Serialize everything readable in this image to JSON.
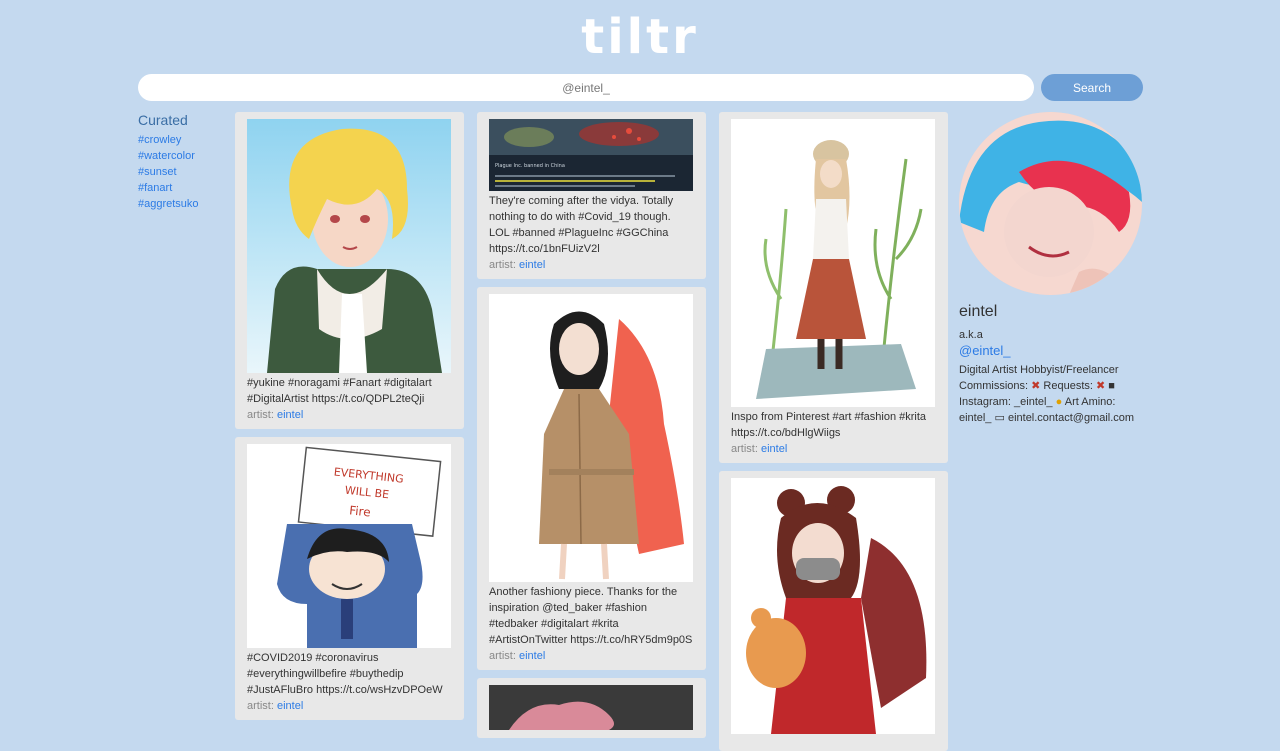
{
  "app": {
    "logo": "tiltr"
  },
  "search": {
    "placeholder": "@eintel_",
    "button_label": "Search"
  },
  "curated": {
    "title": "Curated",
    "tags": [
      "#crowley",
      "#watercolor",
      "#sunset",
      "#fanart",
      "#aggretsuko"
    ]
  },
  "posts": {
    "yukine": {
      "caption": "#yukine #noragami #Fanart #digitalart #DigitalArtist https://t.co/QDPL2teQji",
      "artist_label": "artist:",
      "artist": "eintel"
    },
    "covid": {
      "image_text": "EVERYTHING WILL BE Fire",
      "caption": "#COVID2019 #coronavirus #everythingwillbefire #buythedip #JustAFluBro https://t.co/wsHzvDPOeW",
      "artist_label": "artist:",
      "artist": "eintel"
    },
    "plague": {
      "image_text": "Plague Inc. banned in China",
      "caption": "They're coming after the vidya. Totally nothing to do with #Covid_19 though. LOL #banned #PlagueInc #GGChina https://t.co/1bnFUizV2l",
      "artist_label": "artist:",
      "artist": "eintel"
    },
    "fashion": {
      "caption": "Another fashiony piece. Thanks for the inspiration @ted_baker #fashion #tedbaker #digitalart #krita #ArtistOnTwitter https://t.co/hRY5dm9p0S",
      "artist_label": "artist:",
      "artist": "eintel"
    },
    "pinterest": {
      "caption": "Inspo from Pinterest #art #fashion #krita https://t.co/bdHlgWiigs",
      "artist_label": "artist:",
      "artist": "eintel"
    }
  },
  "profile": {
    "name": "eintel",
    "aka": "a.k.a",
    "handle": "@eintel_",
    "bio_line1": "Digital Artist Hobbyist/Freelancer",
    "commissions_label": "Commissions:",
    "requests_label": "Requests:",
    "instagram_label": "Instagram: _eintel_",
    "art_amino_label": "Art Amino:",
    "art_amino_value": "eintel_",
    "email": "eintel.contact@gmail.com"
  },
  "colors": {
    "background": "#c4d9ef",
    "accent": "#6d9fd6",
    "link": "#2c7be5",
    "card": "#e8e8e8"
  }
}
